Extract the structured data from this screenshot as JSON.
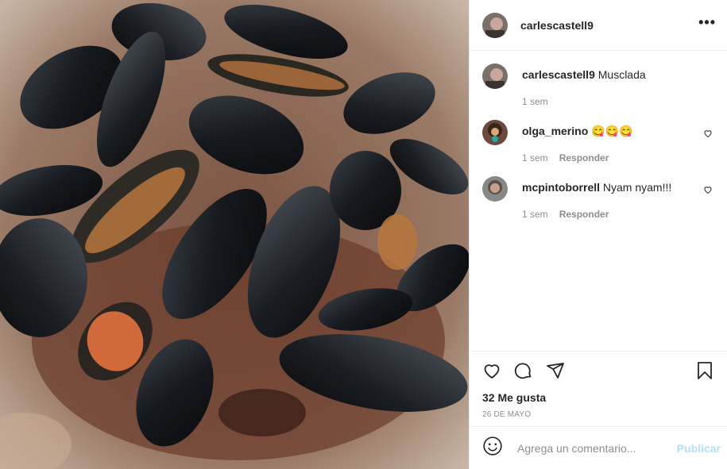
{
  "post": {
    "image_alt": "Mejillones cocidos en una olla",
    "author": "carlescastell9",
    "more_icon": "more-horizontal-icon"
  },
  "comments": [
    {
      "username": "carlescastell9",
      "text": "Musclada",
      "time": "1 sem",
      "reply": ""
    },
    {
      "username": "olga_merino",
      "text": "😋😋😋",
      "time": "1 sem",
      "reply": "Responder"
    },
    {
      "username": "mcpintoborrell",
      "text": "Nyam nyam!!!",
      "time": "1 sem",
      "reply": "Responder"
    }
  ],
  "actions": {
    "likes": "32 Me gusta",
    "date": "26 DE MAYO",
    "icons": [
      "heart-icon",
      "comment-icon",
      "share-icon",
      "bookmark-icon"
    ]
  },
  "add_comment": {
    "placeholder": "Agrega un comentario...",
    "publish_label": "Publicar",
    "publish_color": "#b2dffc"
  }
}
